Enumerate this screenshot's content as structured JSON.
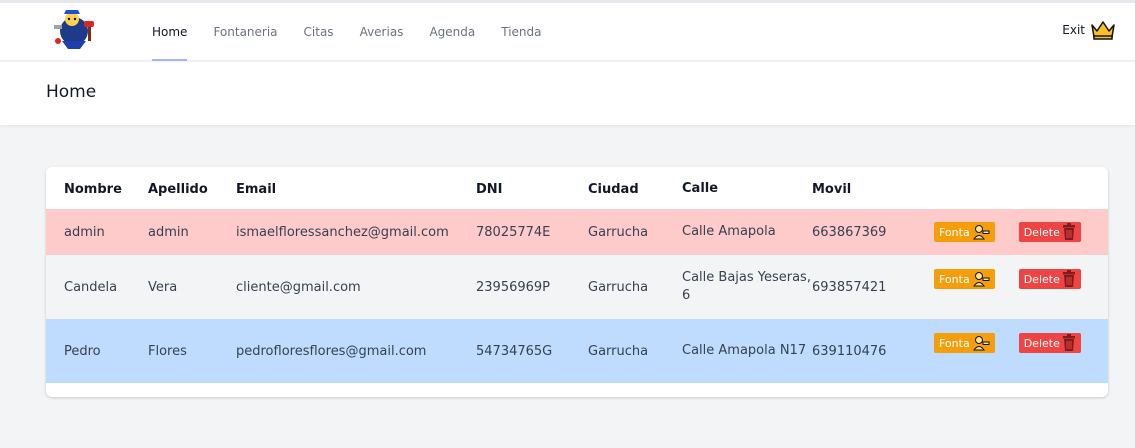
{
  "nav": {
    "items": [
      {
        "label": "Home",
        "active": true
      },
      {
        "label": "Fontaneria",
        "active": false
      },
      {
        "label": "Citas",
        "active": false
      },
      {
        "label": "Averias",
        "active": false
      },
      {
        "label": "Agenda",
        "active": false
      },
      {
        "label": "Tienda",
        "active": false
      }
    ],
    "exit_label": "Exit"
  },
  "header": {
    "title": "Home"
  },
  "table": {
    "columns": [
      "Nombre",
      "Apellido",
      "Email",
      "DNI",
      "Ciudad",
      "Calle",
      "Movil"
    ],
    "rows": [
      {
        "nombre": "admin",
        "apellido": "admin",
        "email": "ismaelfloressanchez@gmail.com",
        "dni": "78025774E",
        "ciudad": "Garrucha",
        "calle": "Calle Amapola",
        "movil": "663867369"
      },
      {
        "nombre": "Candela",
        "apellido": "Vera",
        "email": "cliente@gmail.com",
        "dni": "23956969P",
        "ciudad": "Garrucha",
        "calle": "Calle Bajas Yeseras, 6",
        "movil": "693857421"
      },
      {
        "nombre": "Pedro",
        "apellido": "Flores",
        "email": "pedrofloresflores@gmail.com",
        "dni": "54734765G",
        "ciudad": "Garrucha",
        "calle": "Calle Amapola N17",
        "movil": "639110476"
      }
    ],
    "fonta_label": "Fonta",
    "delete_label": "Delete"
  },
  "colors": {
    "row_admin": "#fecaca",
    "row_client": "#f3f4f6",
    "row_fontanero": "#bfdbfe",
    "fonta_button": "#f59e0b",
    "delete_button": "#ef4444",
    "nav_active_underline": "#a5b4fc"
  },
  "icons": {
    "logo": "plumber-logo",
    "exit": "crown-icon",
    "fonta": "plumber-icon",
    "delete": "trash-icon"
  }
}
